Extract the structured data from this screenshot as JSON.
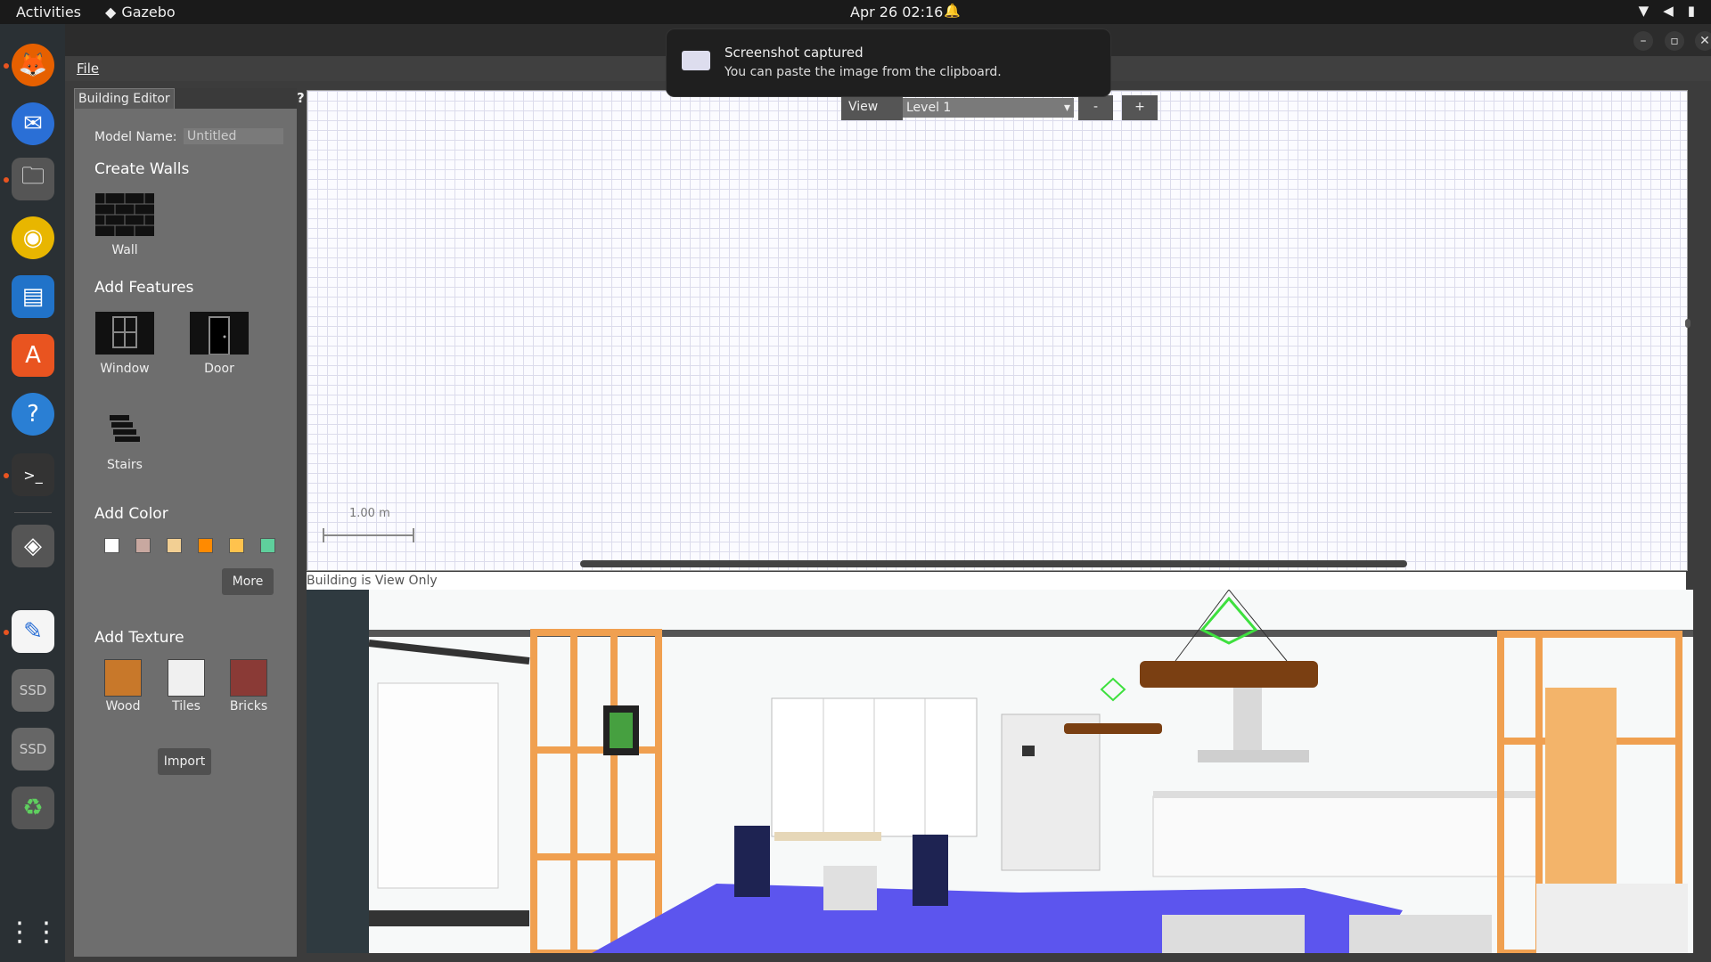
{
  "topbar": {
    "activities": "Activities",
    "app_name": "Gazebo",
    "datetime": "Apr 26  02:16"
  },
  "dock": {
    "items": [
      "Firefox",
      "Thunderbird",
      "Files",
      "Rhythmbox",
      "LibreOffice Writer",
      "Ubuntu Software",
      "Help",
      "Terminal",
      "Gazebo",
      "Text Editor",
      "SSD",
      "SSD",
      "Trash",
      "Show Applications"
    ],
    "ssd_label": "SSD"
  },
  "menu": {
    "file": "File"
  },
  "panel": {
    "tab_label": "Building Editor",
    "help": "?",
    "model_name_label": "Model Name:",
    "model_name_value": "Untitled",
    "create_walls": "Create Walls",
    "wall": "Wall",
    "add_features": "Add Features",
    "window": "Window",
    "door": "Door",
    "stairs": "Stairs",
    "add_color": "Add Color",
    "colors": [
      "#ffffff",
      "#c8a8a0",
      "#f2cf93",
      "#ff8a00",
      "#ffc24d",
      "#5fcf9c"
    ],
    "more": "More",
    "add_texture": "Add Texture",
    "wood": "Wood",
    "tiles": "Tiles",
    "bricks": "Bricks",
    "import": "Import"
  },
  "editor": {
    "view_button": "View",
    "level": "Level 1",
    "minus": "-",
    "plus": "+",
    "scale_label": "1.00 m",
    "status": "Building is View Only"
  },
  "notification": {
    "title": "Screenshot captured",
    "body": "You can paste the image from the clipboard."
  }
}
